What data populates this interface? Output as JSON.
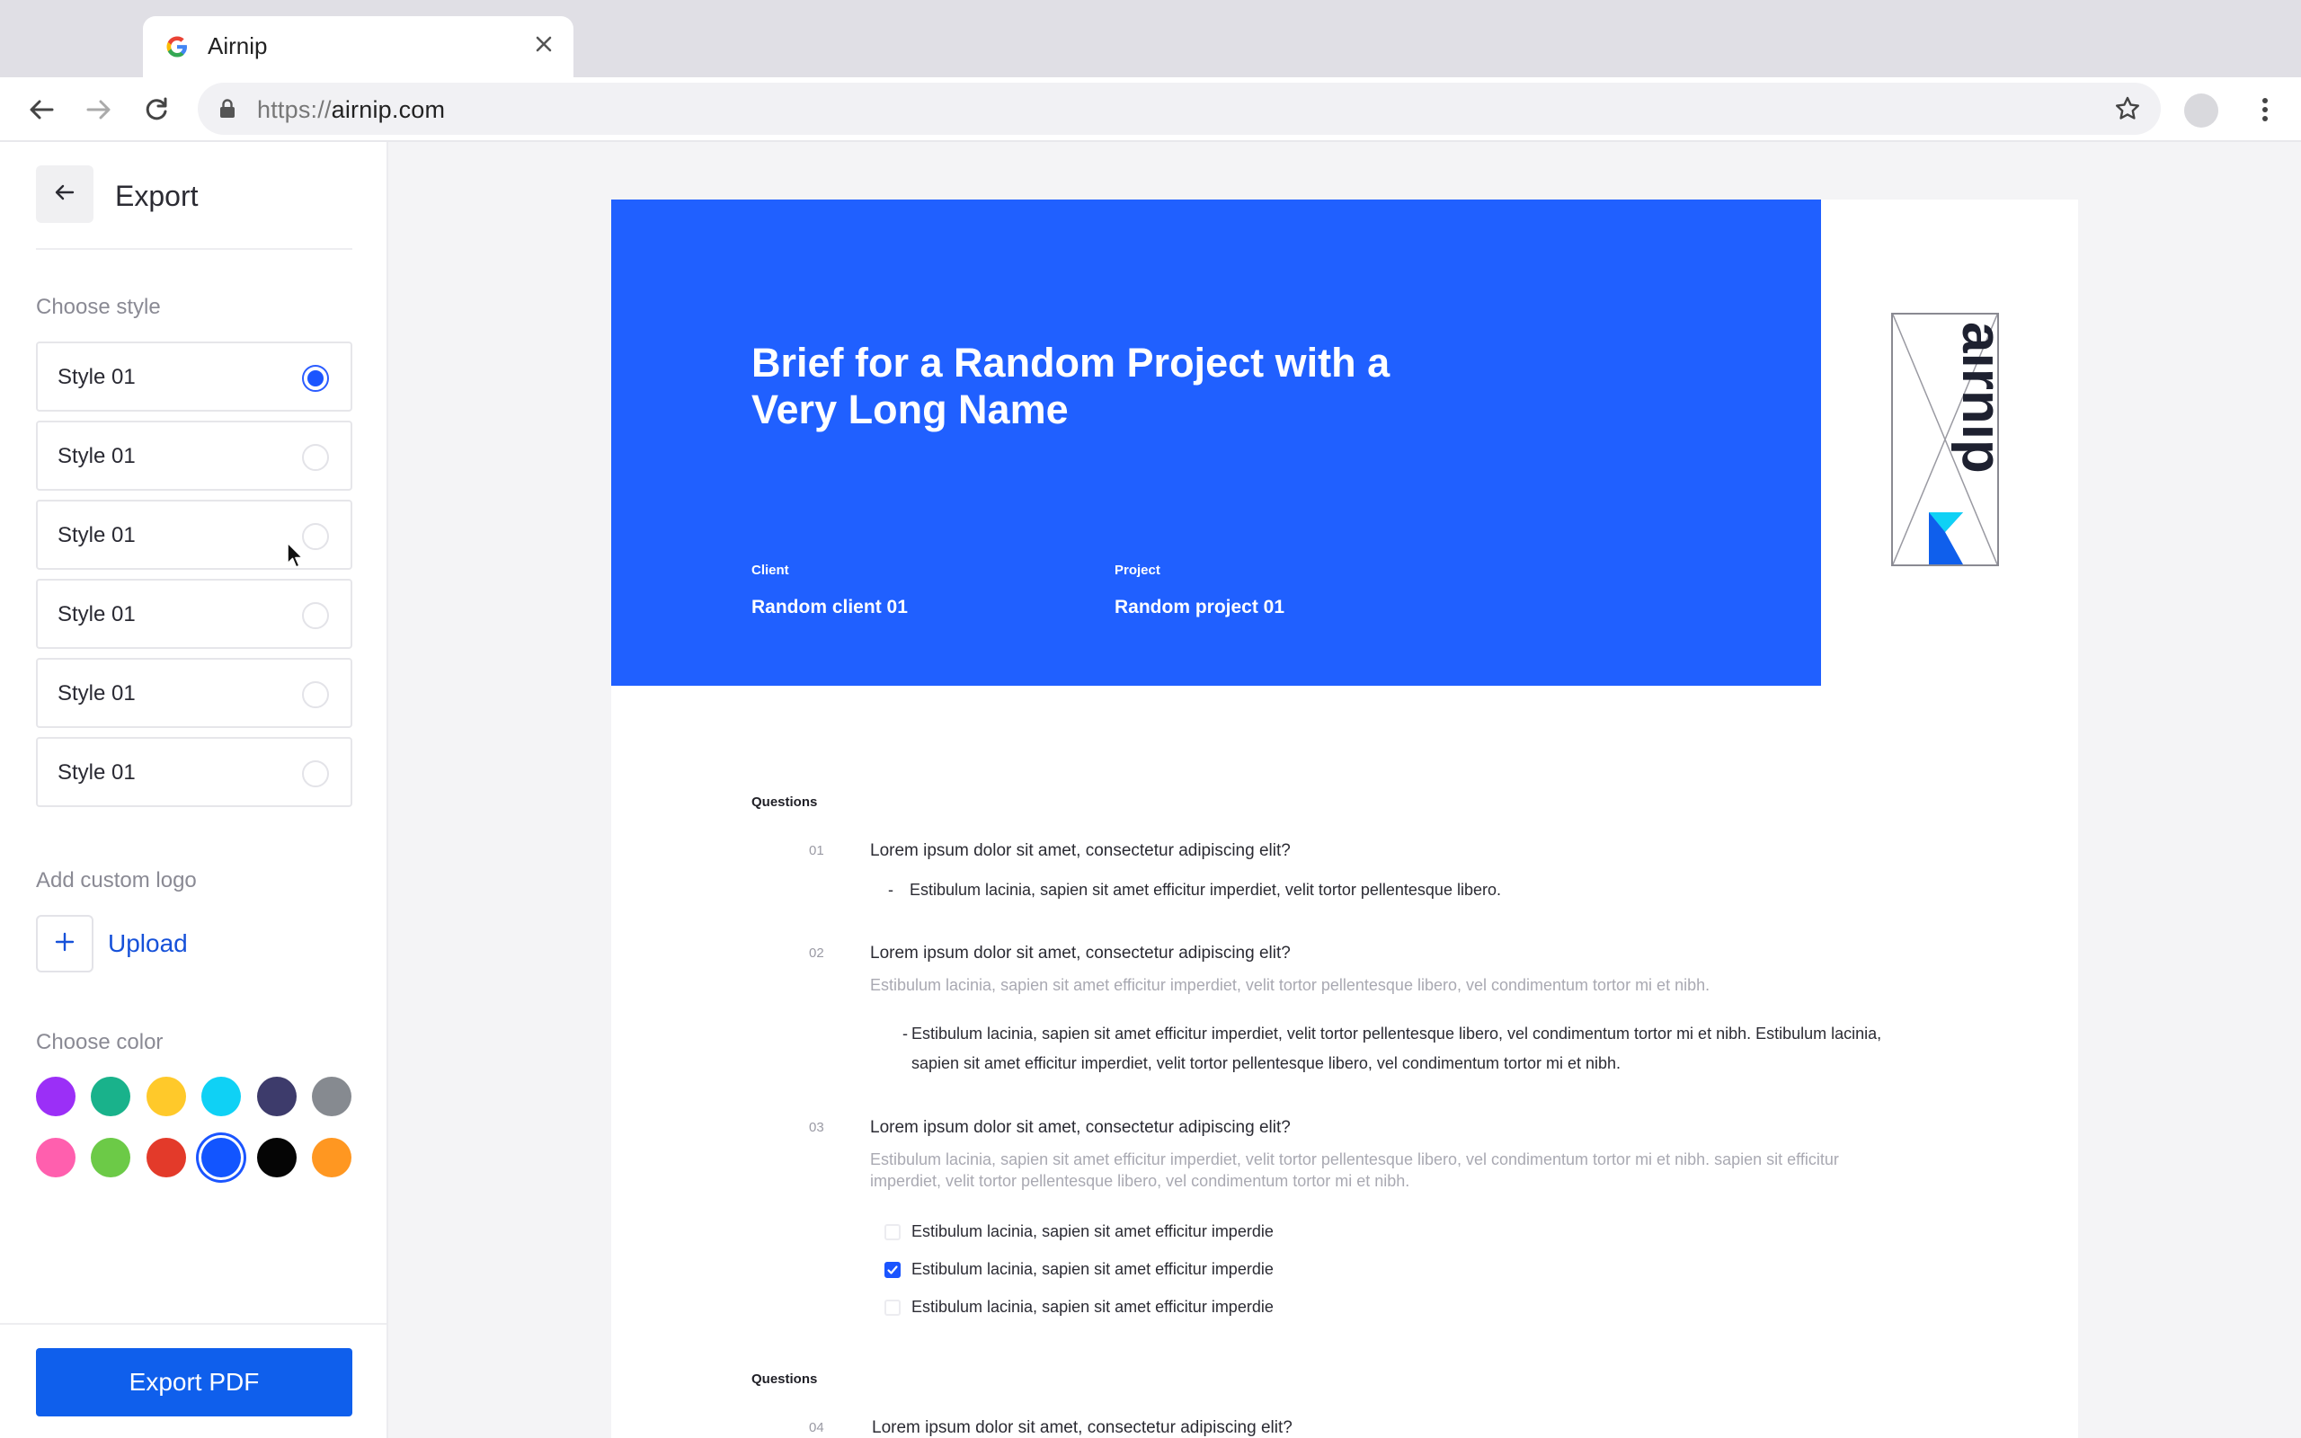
{
  "browser": {
    "tab_title": "Airnip",
    "url_scheme": "https://",
    "url_host": "airnip.com"
  },
  "sidebar": {
    "title": "Export",
    "choose_style_label": "Choose style",
    "styles": [
      {
        "label": "Style 01",
        "selected": true
      },
      {
        "label": "Style 01",
        "selected": false
      },
      {
        "label": "Style 01",
        "selected": false
      },
      {
        "label": "Style 01",
        "selected": false
      },
      {
        "label": "Style 01",
        "selected": false
      },
      {
        "label": "Style 01",
        "selected": false
      }
    ],
    "custom_logo_label": "Add custom logo",
    "upload_label": "Upload",
    "choose_color_label": "Choose color",
    "colors": [
      "#9b2ff7",
      "#19b28b",
      "#ffc92a",
      "#0fd1f5",
      "#3d3b6b",
      "#868a90",
      "#ff5fae",
      "#6cca47",
      "#e33a2a",
      "#1255ff",
      "#050505",
      "#ff9721"
    ],
    "selected_color": "#1255ff",
    "export_label": "Export PDF"
  },
  "document": {
    "title": "Brief for a Random Project with a Very Long Name",
    "client_label": "Client",
    "client_value": "Random client 01",
    "project_label": "Project",
    "project_value": "Random project 01",
    "logo_text": "airnip",
    "questions_heading": "Questions",
    "q1": {
      "num": "01",
      "text": "Lorem ipsum dolor sit amet, consectetur adipiscing elit?",
      "answer": "Estibulum lacinia, sapien sit amet efficitur imperdiet, velit tortor pellentesque libero."
    },
    "q2": {
      "num": "02",
      "text": "Lorem ipsum dolor sit amet, consectetur adipiscing elit?",
      "sub": "Estibulum lacinia, sapien sit amet efficitur imperdiet, velit tortor pellentesque libero, vel condimentum tortor mi et nibh.",
      "answer": "Estibulum lacinia, sapien sit amet efficitur imperdiet, velit tortor pellentesque libero, vel condimentum tortor mi et nibh. Estibulum lacinia, sapien sit amet efficitur imperdiet, velit tortor pellentesque libero, vel condimentum tortor mi et nibh."
    },
    "q3": {
      "num": "03",
      "text": "Lorem ipsum dolor sit amet, consectetur adipiscing elit?",
      "sub": "Estibulum lacinia, sapien sit amet efficitur imperdiet, velit tortor pellentesque libero, vel condimentum tortor mi et nibh. sapien sit efficitur imperdiet, velit tortor pellentesque libero, vel condimentum tortor mi et nibh.",
      "options": [
        {
          "label": "Estibulum lacinia, sapien sit amet efficitur imperdie",
          "checked": false
        },
        {
          "label": "Estibulum lacinia, sapien sit amet efficitur imperdie",
          "checked": true
        },
        {
          "label": "Estibulum lacinia, sapien sit amet efficitur imperdie",
          "checked": false
        }
      ]
    },
    "questions_heading_2": "Questions",
    "q4": {
      "num": "04",
      "text": "Lorem ipsum dolor sit amet, consectetur adipiscing elit?"
    }
  }
}
